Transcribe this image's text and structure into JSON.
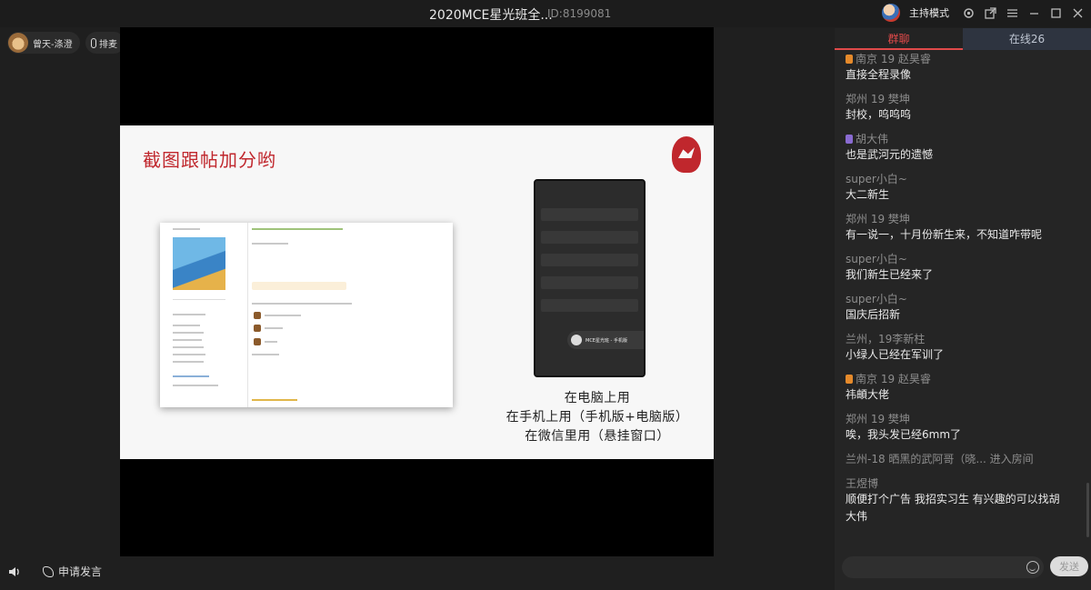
{
  "window": {
    "title": "2020MCE星光班全...",
    "room_id": "ID:8199081",
    "host_mode_label": "主持模式",
    "controls": [
      "settings-icon",
      "popout-icon",
      "menu-icon",
      "minimize-icon",
      "maximize-icon",
      "close-icon"
    ]
  },
  "top_users": {
    "user_name": "曾天-涤澄",
    "mic_label": "排麦"
  },
  "slide": {
    "title": "截图跟帖加分哟",
    "caption_lines": [
      "在电脑上用",
      "在手机上用（手机版+电脑版）",
      "在微信里用（悬挂窗口）"
    ],
    "phone_float_label": "MCE星光班 - 手机版"
  },
  "bottom": {
    "apply_speak_label": "申请发言"
  },
  "panel": {
    "tabs": [
      {
        "label": "群聊",
        "active": true
      },
      {
        "label": "在线26",
        "active": false
      }
    ],
    "messages": [
      {
        "name": "南京 19 赵昊睿",
        "badge": "orange",
        "text": "直接全程录像"
      },
      {
        "name": "郑州 19 樊坤",
        "badge": "",
        "text": "封校，呜呜呜"
      },
      {
        "name": "胡大伟",
        "badge": "purple",
        "text": "也是武河元的遗憾"
      },
      {
        "name": "super小白~",
        "badge": "",
        "text": "大二新生"
      },
      {
        "name": "郑州 19 樊坤",
        "badge": "",
        "text": "有一说一，十月份新生来，不知道咋带呢"
      },
      {
        "name": "super小白~",
        "badge": "",
        "text": "我们新生已经来了"
      },
      {
        "name": "super小白~",
        "badge": "",
        "text": "国庆后招新"
      },
      {
        "name": "兰州，19李新柱",
        "badge": "",
        "text": "小绿人已经在军训了"
      },
      {
        "name": "南京 19 赵昊睿",
        "badge": "orange",
        "text": "祎頔大佬"
      },
      {
        "name": "郑州 19 樊坤",
        "badge": "",
        "text": "唉，我头发已经6mm了"
      }
    ],
    "system_message": "兰州-18 晒黑的武阿哥（晓... 进入房间",
    "last_message": {
      "name": "王煜博",
      "text_line1": "顺便打个广告 我招实习生 有兴趣的可以找胡",
      "text_line2": "大伟"
    },
    "input_placeholder": "",
    "send_label": "发送"
  },
  "colors": {
    "accent_red": "#e04a4a",
    "slide_red": "#c0272d"
  }
}
